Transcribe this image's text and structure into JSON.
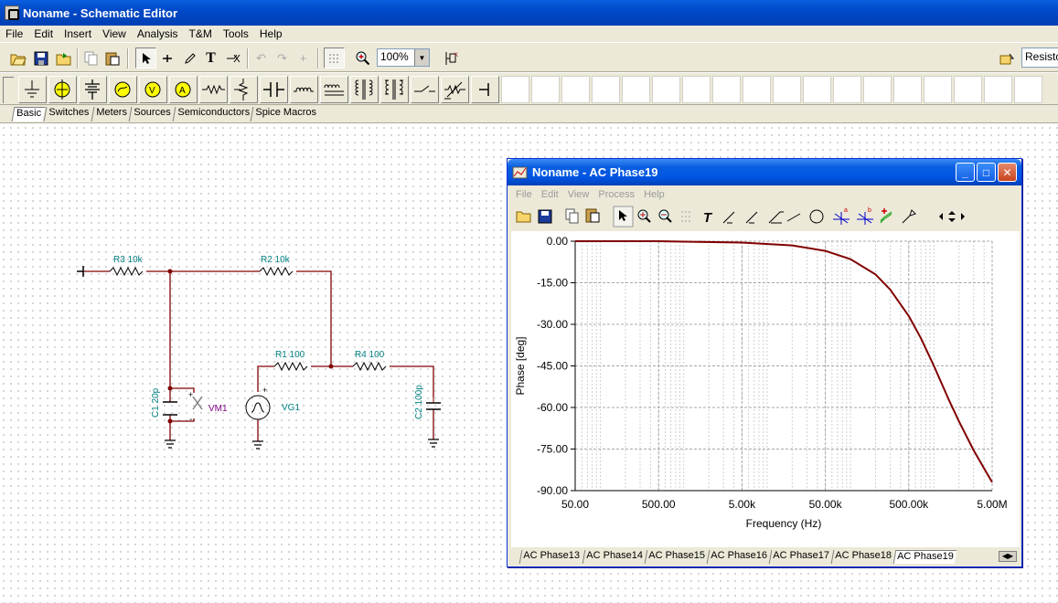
{
  "app": {
    "title": "Noname - Schematic Editor",
    "menu": [
      "File",
      "Edit",
      "Insert",
      "View",
      "Analysis",
      "T&M",
      "Tools",
      "Help"
    ],
    "zoom": "100%",
    "component_search": "Resisto"
  },
  "toolbar_icons": [
    "open-icon",
    "save-icon",
    "open-folder-icon",
    "copy-icon",
    "paste-icon",
    "select-arrow-icon",
    "wire-icon",
    "pencil-icon",
    "text-icon",
    "no-pin-icon",
    "undo-icon",
    "redo-icon",
    "junction-icon",
    "grid-icon",
    "zoom-icon",
    "probe-icon",
    "component-finder-icon"
  ],
  "component_icons": [
    "ground-icon",
    "battery-icon",
    "multi-battery-icon",
    "voltage-source-icon",
    "voltmeter-icon",
    "ammeter-icon",
    "resistor-icon",
    "potentiometer-icon",
    "capacitor-icon",
    "inductor-icon",
    "coupled-inductor-icon",
    "transformer-icon",
    "transformer-2-icon",
    "switch-icon",
    "variable-resistor-icon",
    "terminal-icon"
  ],
  "component_tabs": [
    "Basic",
    "Switches",
    "Meters",
    "Sources",
    "Semiconductors",
    "Spice Macros"
  ],
  "schematic": {
    "labels": {
      "r3": "R3 10k",
      "r2": "R2 10k",
      "r1": "R1 100",
      "r4": "R4 100",
      "c1": "C1 20p",
      "c2": "C2 100p",
      "vm1": "VM1",
      "vg1": "VG1",
      "plus": "+",
      "minus": "-"
    }
  },
  "analysis_window": {
    "title": "Noname - AC Phase19",
    "menu": [
      "File",
      "Edit",
      "View",
      "Process",
      "Help"
    ],
    "window_buttons": {
      "min": "_",
      "max": "□",
      "close": "✕"
    },
    "tabs": [
      "AC Phase13",
      "AC Phase14",
      "AC Phase15",
      "AC Phase16",
      "AC Phase17",
      "AC Phase18",
      "AC Phase19"
    ]
  },
  "chart_data": {
    "type": "line",
    "xlabel": "Frequency (Hz)",
    "ylabel": "Phase [deg]",
    "x_scale": "log",
    "xlim": [
      50,
      5000000
    ],
    "ylim": [
      -90,
      0
    ],
    "x_tick_labels": [
      "50.00",
      "500.00",
      "5.00k",
      "50.00k",
      "500.00k",
      "5.00M"
    ],
    "y_tick_labels": [
      "0.00",
      "-15.00",
      "-30.00",
      "-45.00",
      "-60.00",
      "-75.00",
      "-90.00"
    ],
    "grid": true,
    "series": [
      {
        "color": "#800000",
        "x": [
          50,
          500,
          5000,
          20000,
          50000,
          100000,
          200000,
          300000,
          500000,
          700000,
          1000000,
          1500000,
          2000000,
          3000000,
          4000000,
          5000000
        ],
        "values": [
          0,
          0,
          -0.5,
          -1.5,
          -3.5,
          -6.5,
          -12,
          -17.5,
          -27,
          -35,
          -45,
          -57,
          -65,
          -75.5,
          -82,
          -87
        ]
      }
    ]
  }
}
